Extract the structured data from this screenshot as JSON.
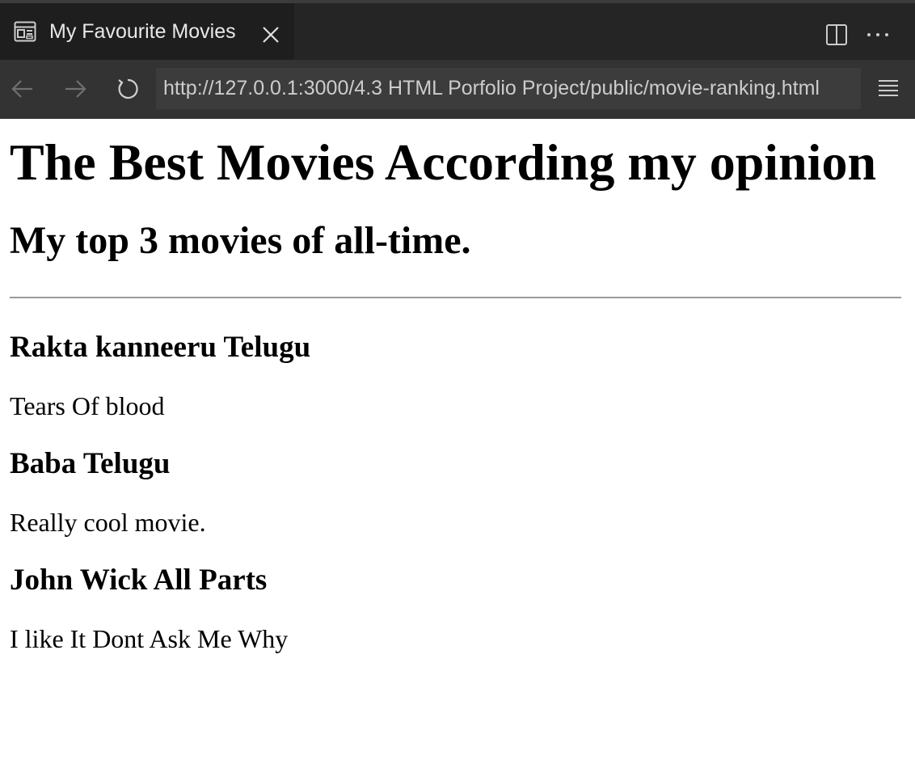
{
  "tab": {
    "title": "My Favourite Movies",
    "icon": "preview-icon"
  },
  "toolbar": {
    "url": "http://127.0.0.1:3000/4.3 HTML Porfolio Project/public/movie-ranking.html"
  },
  "page": {
    "title": "The Best Movies According my opinion",
    "subtitle": "My top 3 movies of all-time.",
    "movies": [
      {
        "name": "Rakta kanneeru Telugu",
        "description": "Tears Of blood"
      },
      {
        "name": "Baba Telugu",
        "description": "Really cool movie."
      },
      {
        "name": "John Wick All Parts",
        "description": "I like It Dont Ask Me Why"
      }
    ]
  },
  "colors": {
    "tabbar_bg": "#252526",
    "active_tab_bg": "#1e1e1e",
    "navbar_bg": "#333333",
    "url_bg": "#3c3c3c"
  }
}
